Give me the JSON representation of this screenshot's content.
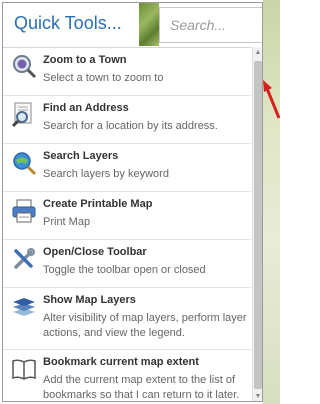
{
  "header": {
    "title": "Quick Tools...",
    "search_placeholder": "Search..."
  },
  "tools": [
    {
      "icon": "magnifier-globe-icon",
      "title": "Zoom to a Town",
      "description": "Select a town to zoom to"
    },
    {
      "icon": "address-search-icon",
      "title": "Find an Address",
      "description": "Search for a location by its address."
    },
    {
      "icon": "layer-search-icon",
      "title": "Search Layers",
      "description": "Search layers by keyword"
    },
    {
      "icon": "printer-icon",
      "title": "Create Printable Map",
      "description": "Print Map"
    },
    {
      "icon": "tools-icon",
      "title": "Open/Close Toolbar",
      "description": "Toggle the toolbar open or closed"
    },
    {
      "icon": "layers-icon",
      "title": "Show Map Layers",
      "description": "Alter visibility of map layers, perform layer actions, and view the legend."
    },
    {
      "icon": "book-icon",
      "title": "Bookmark current map extent",
      "description": "Add the current map extent to the list of bookmarks so that I can return to it later."
    }
  ],
  "colors": {
    "title_blue": "#2b6fb3",
    "arrow_red": "#d62020"
  }
}
